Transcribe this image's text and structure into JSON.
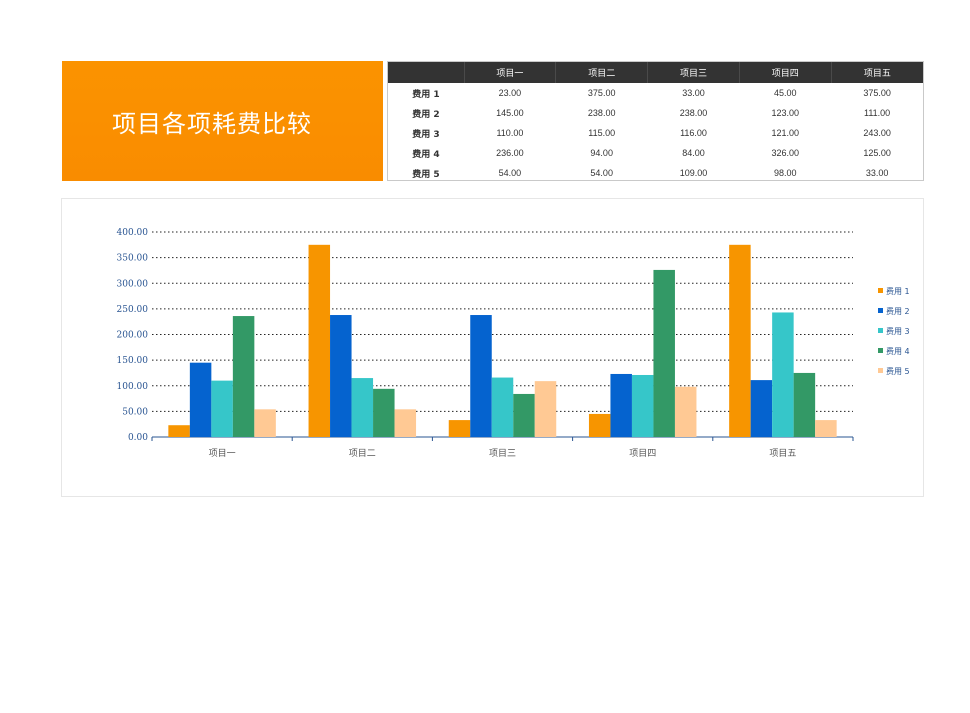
{
  "title": "项目各项耗费比较",
  "table": {
    "header": [
      "",
      "项目一",
      "项目二",
      "项目三",
      "项目四",
      "项目五"
    ],
    "rows": [
      {
        "label": "费用 1",
        "cells": [
          "23.00",
          "375.00",
          "33.00",
          "45.00",
          "375.00"
        ]
      },
      {
        "label": "费用 2",
        "cells": [
          "145.00",
          "238.00",
          "238.00",
          "123.00",
          "111.00"
        ]
      },
      {
        "label": "费用 3",
        "cells": [
          "110.00",
          "115.00",
          "116.00",
          "121.00",
          "243.00"
        ]
      },
      {
        "label": "费用 4",
        "cells": [
          "236.00",
          "94.00",
          "84.00",
          "326.00",
          "125.00"
        ]
      },
      {
        "label": "费用 5",
        "cells": [
          "54.00",
          "54.00",
          "109.00",
          "98.00",
          "33.00"
        ]
      }
    ]
  },
  "colors": {
    "费用 1": "#f79500",
    "费用 2": "#0563cf",
    "费用 3": "#36c6c9",
    "费用 4": "#339966",
    "费用 5": "#ffc994",
    "title_bg": "#fb9300",
    "header_bg": "#333333"
  },
  "chart_data": {
    "type": "bar",
    "categories": [
      "项目一",
      "项目二",
      "项目三",
      "项目四",
      "项目五"
    ],
    "series": [
      {
        "name": "费用 1",
        "values": [
          23,
          375,
          33,
          45,
          375
        ]
      },
      {
        "name": "费用 2",
        "values": [
          145,
          238,
          238,
          123,
          111
        ]
      },
      {
        "name": "费用 3",
        "values": [
          110,
          115,
          116,
          121,
          243
        ]
      },
      {
        "name": "费用 4",
        "values": [
          236,
          94,
          84,
          326,
          125
        ]
      },
      {
        "name": "费用 5",
        "values": [
          54,
          54,
          109,
          98,
          33
        ]
      }
    ],
    "ylim": [
      0,
      400
    ],
    "yticks": [
      "0.00",
      "50.00",
      "100.00",
      "150.00",
      "200.00",
      "250.00",
      "300.00",
      "350.00",
      "400.00"
    ],
    "grid": true,
    "legend": "right",
    "xlabel": "",
    "ylabel": ""
  }
}
